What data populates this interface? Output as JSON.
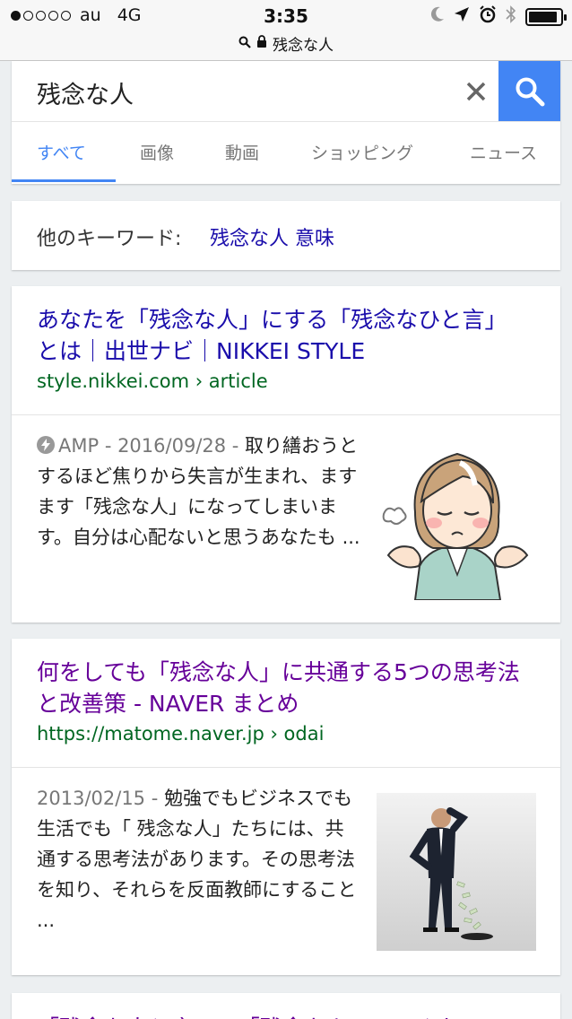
{
  "status_bar": {
    "carrier": "au",
    "network": "4G",
    "time": "3:35",
    "signal_bars": 1,
    "battery_level": 0.9,
    "address": "残念な人"
  },
  "search": {
    "query": "残念な人",
    "tabs": [
      {
        "label": "すべて",
        "active": true
      },
      {
        "label": "画像"
      },
      {
        "label": "動画"
      },
      {
        "label": "ショッピング"
      },
      {
        "label": "ニュース"
      }
    ]
  },
  "keywords": {
    "label": "他のキーワード:",
    "link": "残念な人 意味"
  },
  "results": [
    {
      "title": "あなたを「残念な人」にする「残念なひと言」とは｜出世ナビ｜NIKKEI STYLE",
      "url": "style.nikkei.com › article",
      "meta": "AMP - 2016/09/28 - ",
      "snippet": "取り繕おうとするほど焦りから失言が生まれ、ますます「残念な人」になってしまいます。自分は心配ないと思うあなたも ...",
      "thumbnail": "worried-woman-illustration"
    },
    {
      "title": "何をしても「残念な人」に共通する5つの思考法と改善策 - NAVER まとめ",
      "url": "https://matome.naver.jp › odai",
      "meta": "2013/02/15 - ",
      "snippet": "勉強でもビジネスでも生活でも「 残念な人」たちには、共通する思考法があります。その思考法を知り、それらを反面教師にすること ...",
      "thumbnail": "businessman-losing-money-photo"
    }
  ],
  "partial_result": {
    "title": "「残念な人と言って「残念なキャ…ゃんれ…ている"
  }
}
